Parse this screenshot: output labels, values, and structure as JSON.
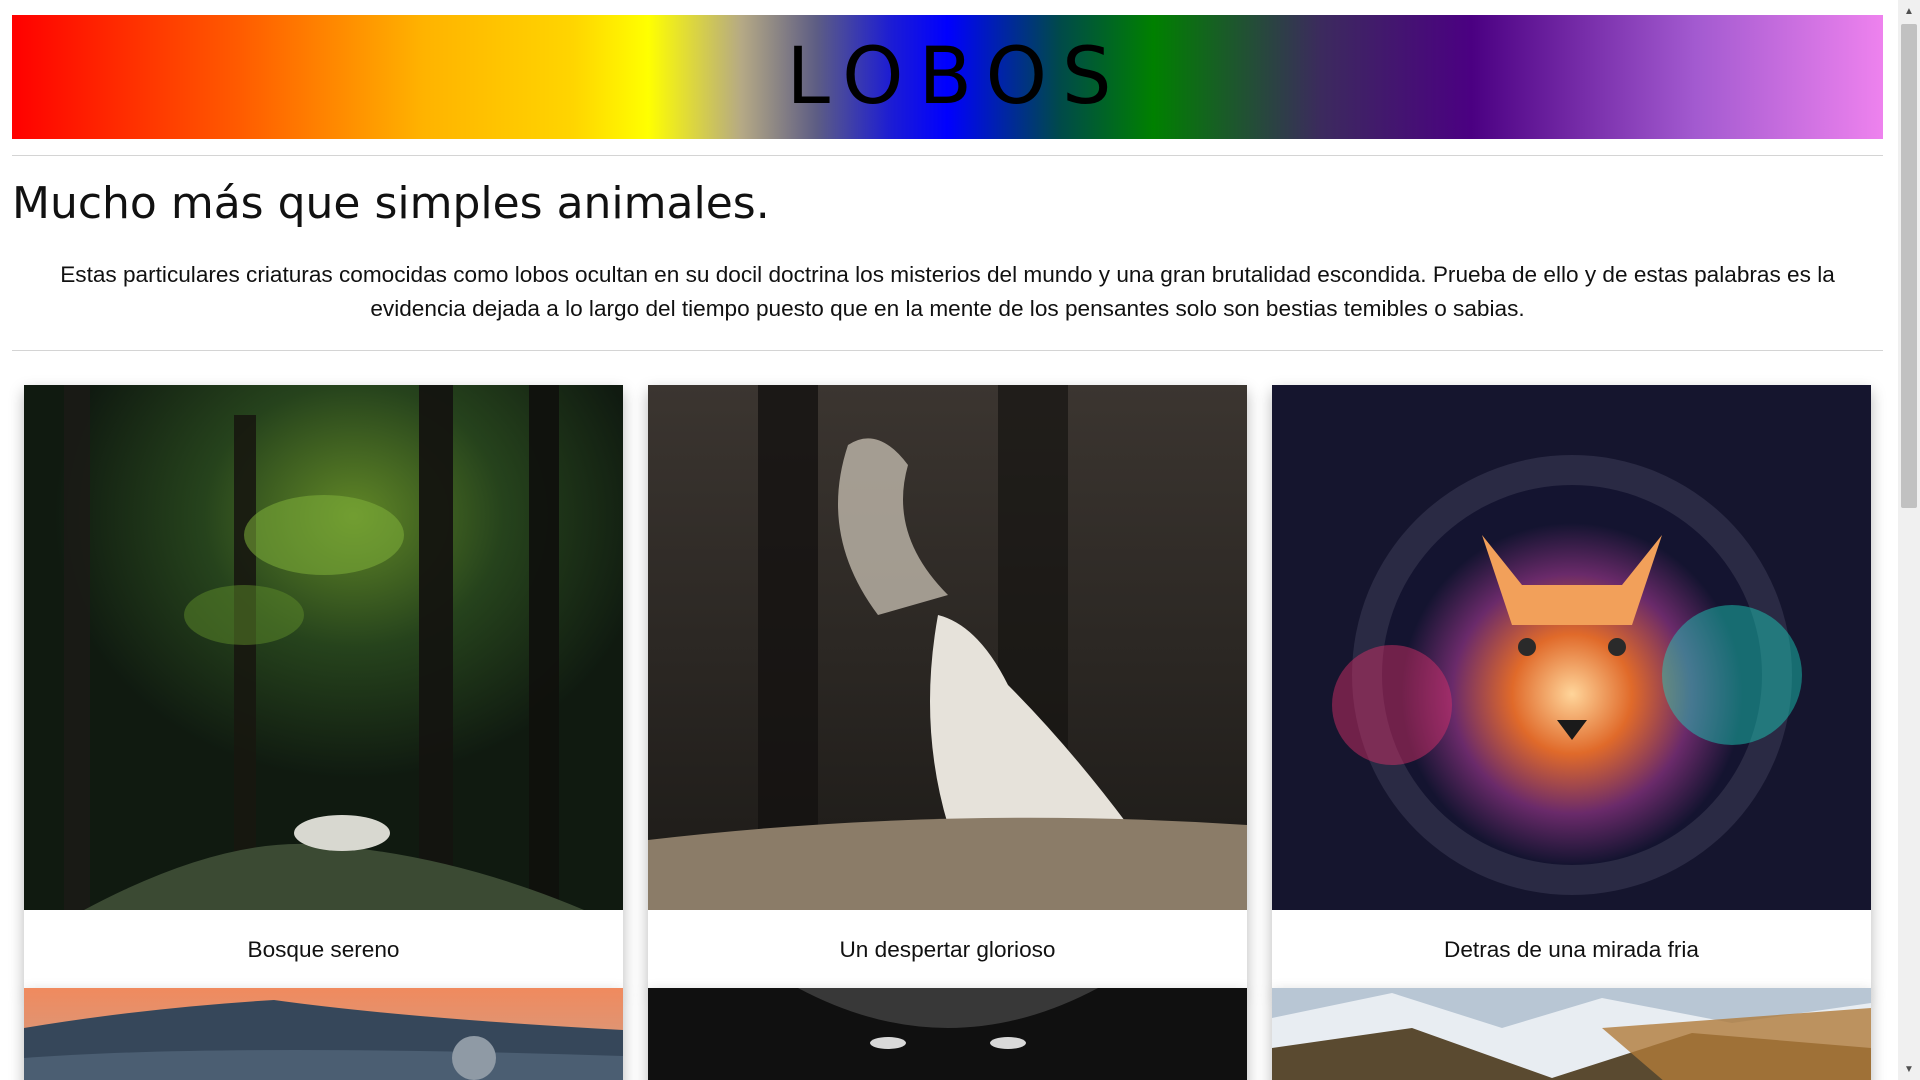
{
  "header": {
    "title": "LOBOS"
  },
  "main": {
    "headline": "Mucho más que simples animales.",
    "intro": "Estas particulares criaturas comocidas como lobos ocultan en su docil doctrina los misterios del mundo y una gran brutalidad escondida. Prueba de ello y de estas palabras es la evidencia dejada a lo largo del tiempo puesto que en la mente de los pensantes solo son bestias temibles o sabias."
  },
  "gallery": {
    "cards": [
      {
        "caption": "Bosque sereno",
        "image": "wolf-sleeping-in-forest"
      },
      {
        "caption": "Un despertar glorioso",
        "image": "white-wolf-howling-breath"
      },
      {
        "caption": "Detras de una mirada fria",
        "image": "cosmic-wolf-portrait"
      },
      {
        "caption": "",
        "image": "mountain-sunset-wolf"
      },
      {
        "caption": "",
        "image": "dark-wolf-eyes"
      },
      {
        "caption": "",
        "image": "snowy-mountain-valley"
      }
    ]
  },
  "colors": {
    "banner_gradient": [
      "#ff0000",
      "#ffa500",
      "#ffff00",
      "#0000ff",
      "#008000",
      "#4b0082",
      "#ee82ee"
    ],
    "divider": "#d4d4d4",
    "text": "#111111"
  },
  "scrollbar": {
    "up_icon": "triangle-up-icon",
    "down_icon": "triangle-down-icon"
  }
}
